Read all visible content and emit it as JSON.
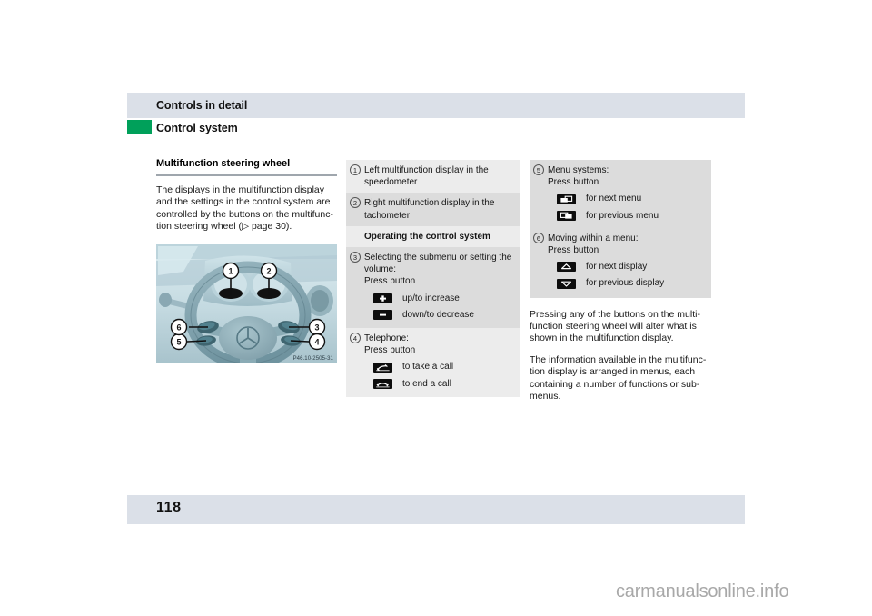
{
  "header": {
    "chapter_title": "Controls in detail",
    "section_title": "Control system",
    "accent_color": "#00a05a",
    "band_color": "#dbe0e8"
  },
  "left_column": {
    "subheading": "Multifunction steering wheel",
    "paragraph": "The displays in the multifunction display and the settings in the control system are controlled by the buttons on the multifunc-tion steering wheel (▷ page 30).",
    "figure": {
      "alt": "multifunction-steering-wheel-photo",
      "code": "P46.10-2505-31",
      "callouts": [
        "1",
        "2",
        "3",
        "4",
        "5",
        "6"
      ]
    }
  },
  "middle_box": {
    "rows": [
      {
        "num": "1",
        "text": "Left multifunction display in the speedometer",
        "shade": "a"
      },
      {
        "num": "2",
        "text": "Right multifunction display in the tachometer",
        "shade": "b"
      },
      {
        "num": "",
        "text": "Operating the control system",
        "shade": "a",
        "heading": true
      },
      {
        "num": "3",
        "text": "Selecting the submenu or setting the volume:\nPress button",
        "shade": "b"
      }
    ],
    "volume_buttons": [
      {
        "icon": "plus-button-icon",
        "caption": "up/to increase"
      },
      {
        "icon": "minus-button-icon",
        "caption": "down/to decrease"
      }
    ],
    "telephone_row": {
      "num": "4",
      "text": "Telephone:\nPress button"
    },
    "telephone_buttons": [
      {
        "icon": "phone-accept-icon",
        "caption": "to take a call"
      },
      {
        "icon": "phone-end-icon",
        "caption": "to end a call"
      }
    ]
  },
  "right_box": {
    "menu_row": {
      "num": "5",
      "text": "Menu systems:\nPress button"
    },
    "menu_buttons": [
      {
        "icon": "next-menu-icon",
        "caption": "for next menu"
      },
      {
        "icon": "previous-menu-icon",
        "caption": "for previous menu"
      }
    ],
    "moving_row": {
      "num": "6",
      "text": "Moving within a menu:\nPress button"
    },
    "moving_buttons": [
      {
        "icon": "arrow-up-button-icon",
        "caption": "for next display"
      },
      {
        "icon": "arrow-down-button-icon",
        "caption": "for previous display"
      }
    ]
  },
  "right_column": {
    "paragraph_1": "Pressing any of the buttons on the multi-function steering wheel will alter what is shown in the multifunction display.",
    "paragraph_2": "The information available in the multifunc-tion display is arranged in menus, each containing a number of functions or sub-menus."
  },
  "footer": {
    "page_number": "118",
    "watermark": "carmanualsonline.info"
  }
}
